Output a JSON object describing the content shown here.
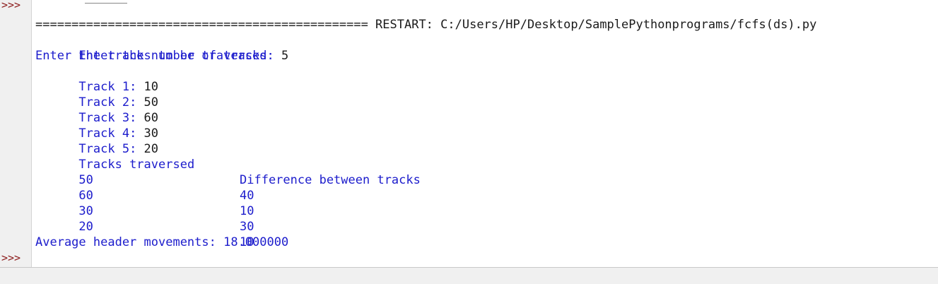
{
  "shell": {
    "prompt_symbol": ">>>",
    "restart_line": "============================================== RESTART: C:/Users/HP/Desktop/SamplePythonprograms/fcfs(ds).py",
    "lines": {
      "num_tracks_label": "Enter the number of tracks: ",
      "num_tracks_value": "5",
      "enter_tracks_label": "Enter the tracks to be traversed:",
      "track1_label": "Track 1: ",
      "track1_value": "10",
      "track2_label": "Track 2: ",
      "track2_value": "50",
      "track3_label": "Track 3: ",
      "track3_value": "60",
      "track4_label": "Track 4: ",
      "track4_value": "30",
      "track5_label": "Track 5: ",
      "track5_value": "20"
    },
    "table": {
      "header_left": "Tracks traversed",
      "header_right": "Difference between tracks",
      "rows": [
        {
          "track": "50",
          "diff": "40"
        },
        {
          "track": "60",
          "diff": "10"
        },
        {
          "track": "30",
          "diff": "30"
        },
        {
          "track": "20",
          "diff": "10"
        }
      ]
    },
    "average_line": "Average header movements: 18.000000"
  }
}
